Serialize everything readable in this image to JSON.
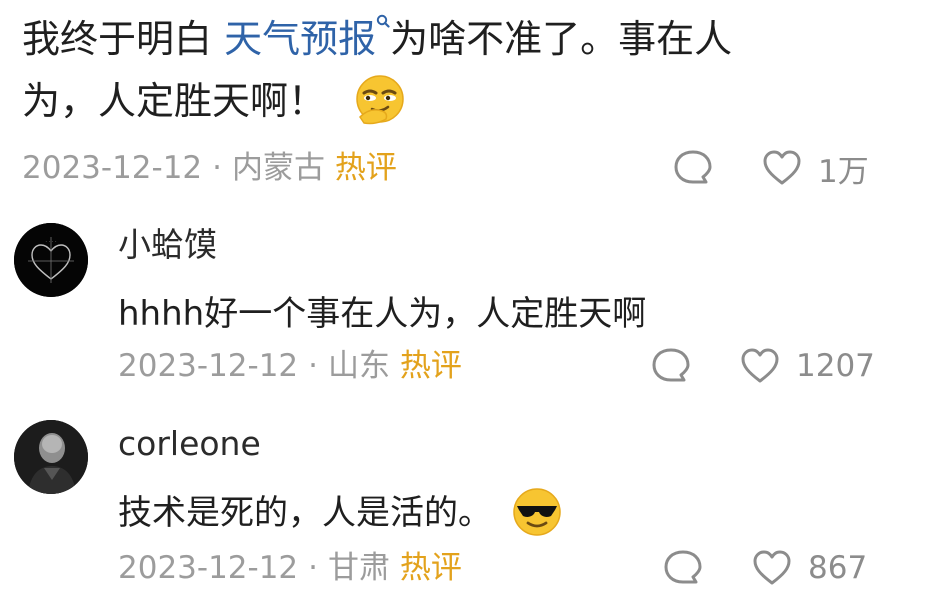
{
  "main_comment": {
    "text_before_link": "我终于明白 ",
    "link_text": "天气预报",
    "text_after_link": "为啥不准了。事在人",
    "text_line2": "为，人定胜天啊！",
    "emoji_icon": "smirk-emoji-icon",
    "date": "2023-12-12",
    "separator": "·",
    "location": "内蒙古",
    "hot_label": "热评",
    "likes": "1万"
  },
  "replies": [
    {
      "username": "小蛤馍",
      "text": "hhhh好一个事在人为，人定胜天啊",
      "date": "2023-12-12",
      "separator": "·",
      "location": "山东",
      "hot_label": "热评",
      "likes": "1207"
    },
    {
      "username": "corleone",
      "text": "技术是死的，人是活的。",
      "emoji_icon": "sunglasses-emoji-icon",
      "date": "2023-12-12",
      "separator": "·",
      "location": "甘肃",
      "hot_label": "热评",
      "likes": "867"
    }
  ],
  "colors": {
    "link": "#2f63a8",
    "hot": "#e3a21c",
    "meta": "#9c9c9c",
    "text": "#1f1f1f"
  }
}
